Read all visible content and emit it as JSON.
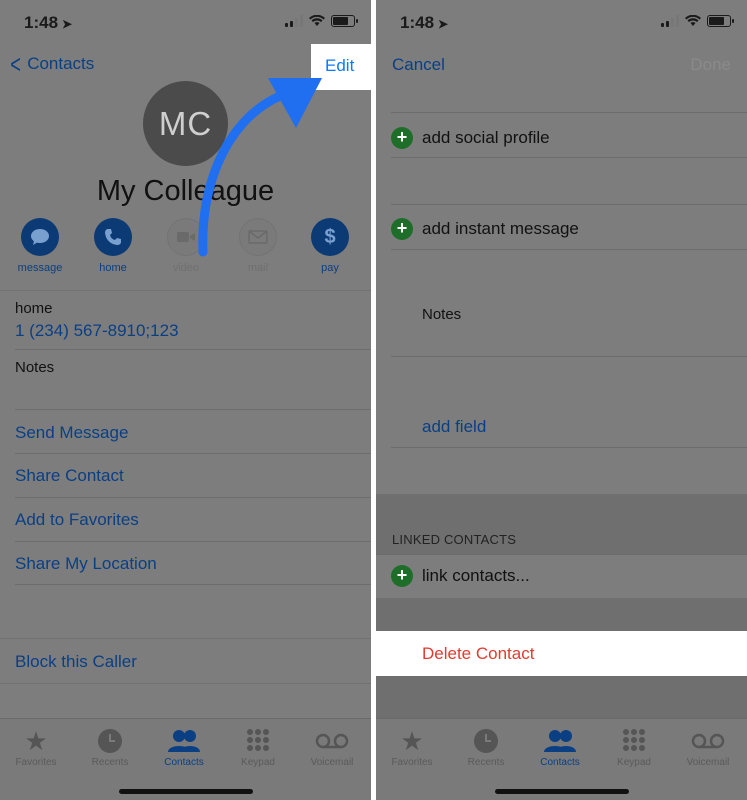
{
  "left": {
    "status": {
      "time": "1:48"
    },
    "nav": {
      "back_label": "Contacts",
      "edit_label": "Edit"
    },
    "contact": {
      "initials": "MC",
      "name": "My Colleague",
      "actions": [
        {
          "label": "message",
          "enabled": true,
          "icon": "message-icon"
        },
        {
          "label": "home",
          "enabled": true,
          "icon": "phone-icon"
        },
        {
          "label": "video",
          "enabled": false,
          "icon": "video-icon"
        },
        {
          "label": "mail",
          "enabled": false,
          "icon": "mail-icon"
        },
        {
          "label": "pay",
          "enabled": true,
          "icon": "dollar-icon"
        }
      ]
    },
    "phone": {
      "label": "home",
      "value": "1 (234) 567-8910;123"
    },
    "notes_label": "Notes",
    "links": [
      "Send Message",
      "Share Contact",
      "Add to Favorites",
      "Share My Location"
    ],
    "block_label": "Block this Caller"
  },
  "right": {
    "status": {
      "time": "1:48"
    },
    "nav": {
      "cancel_label": "Cancel",
      "done_label": "Done"
    },
    "rows": {
      "add_social": "add social profile",
      "add_instant": "add instant message",
      "notes": "Notes",
      "add_field": "add field",
      "linked_header": "LINKED CONTACTS",
      "link_contacts": "link contacts...",
      "delete": "Delete Contact"
    }
  },
  "tabbar": {
    "tabs": [
      {
        "label": "Favorites",
        "icon": "star-icon"
      },
      {
        "label": "Recents",
        "icon": "clock-icon"
      },
      {
        "label": "Contacts",
        "icon": "contacts-icon",
        "active": true
      },
      {
        "label": "Keypad",
        "icon": "keypad-icon"
      },
      {
        "label": "Voicemail",
        "icon": "voicemail-icon"
      }
    ]
  },
  "colors": {
    "ios_blue": "#0a7aff",
    "dimmed_blue": "#0a3f84",
    "delete_red": "#e23a30",
    "add_green": "#1e6e2a",
    "overlay_gray": "#7d7d7d",
    "arrow_blue": "#1f6ff0"
  }
}
